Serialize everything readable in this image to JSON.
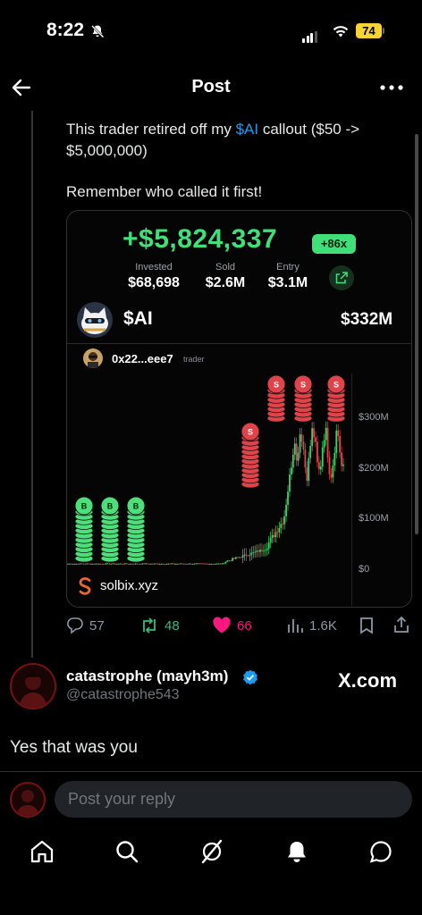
{
  "status": {
    "time": "8:22",
    "battery": "74"
  },
  "header": {
    "title": "Post"
  },
  "post": {
    "text_before": "This trader retired off my ",
    "tag": "$AI",
    "text_after": " callout ($50 -> $5,000,000)",
    "line2": "Remember who called it first!"
  },
  "card": {
    "profit": "+$5,824,337",
    "multiplier": "+86x",
    "invested_label": "Invested",
    "invested_value": "$68,698",
    "sold_label": "Sold",
    "sold_value": "$2.6M",
    "entry_label": "Entry",
    "entry_value": "$3.1M",
    "token": "$AI",
    "market_cap": "$332M",
    "trader_address": "0x22...eee7",
    "trader_label": "trader",
    "site": "solbix.xyz",
    "buy_marker": "B",
    "sell_marker": "S"
  },
  "chart_data": {
    "type": "candlestick",
    "y_ticks": [
      "$300M",
      "$200M",
      "$100M",
      "$0"
    ],
    "ylim": [
      0,
      350
    ],
    "unit": "$M",
    "markers": [
      {
        "type": "B",
        "position": "early"
      },
      {
        "type": "B",
        "position": "early"
      },
      {
        "type": "B",
        "position": "early"
      },
      {
        "type": "S",
        "position": "mid"
      },
      {
        "type": "S",
        "position": "late"
      },
      {
        "type": "S",
        "position": "late"
      },
      {
        "type": "S",
        "position": "late"
      }
    ]
  },
  "actions": {
    "replies": "57",
    "reposts": "48",
    "likes": "66",
    "views": "1.6K"
  },
  "reply": {
    "name": "catastrophe (mayh3m)",
    "handle": "@catastrophe543",
    "badge": "X.com",
    "text": "Yes that was you"
  },
  "composer": {
    "placeholder": "Post your reply"
  },
  "colors": {
    "accent": "#1d9bf0",
    "profit": "#3fe077",
    "like": "#f91880",
    "repost": "#2ec07d"
  }
}
